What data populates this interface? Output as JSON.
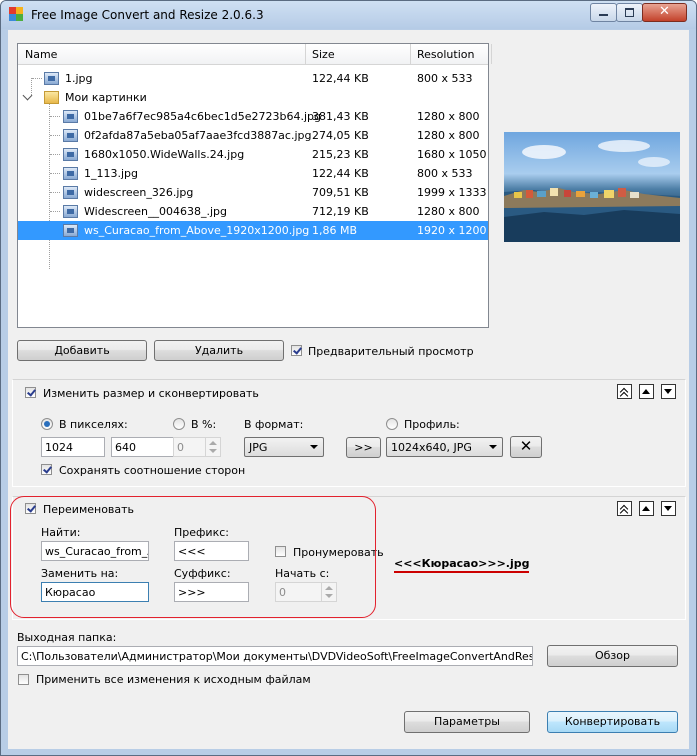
{
  "window": {
    "title": "Free Image Convert and Resize 2.0.6.3"
  },
  "filelist": {
    "columns": [
      "Name",
      "Size",
      "Resolution"
    ],
    "rows": [
      {
        "name": "1.jpg",
        "size": "122,44 KB",
        "res": "800 x 533"
      },
      {
        "name": "Мои картинки",
        "size": "",
        "res": ""
      },
      {
        "name": "01be7a6f7ec985a4c6bec1d5e2723b64.jpg",
        "size": "381,43 KB",
        "res": "1280 x 800"
      },
      {
        "name": "0f2afda87a5eba05af7aae3fcd3887ac.jpg",
        "size": "274,05 KB",
        "res": "1280 x 800"
      },
      {
        "name": "1680x1050.WideWalls.24.jpg",
        "size": "215,23 KB",
        "res": "1680 x 1050"
      },
      {
        "name": "1_113.jpg",
        "size": "122,44 KB",
        "res": "800 x 533"
      },
      {
        "name": "widescreen_326.jpg",
        "size": "709,51 KB",
        "res": "1999 x 1333"
      },
      {
        "name": "Widescreen__004638_.jpg",
        "size": "712,19 KB",
        "res": "1280 x 800"
      },
      {
        "name": "ws_Curacao_from_Above_1920x1200.jpg",
        "size": "1,86 MB",
        "res": "1920 x 1200"
      }
    ]
  },
  "buttons": {
    "add": "Добавить",
    "remove": "Удалить",
    "browse": "Обзор",
    "params": "Параметры",
    "convert": "Конвертировать",
    "arrow": ">>"
  },
  "preview_label": "Предварительный просмотр",
  "resize": {
    "header": "Изменить размер и сконвертировать",
    "pixels_label": "В пикселях:",
    "percent_label": "В %:",
    "format_label": "В формат:",
    "profile_label": "Профиль:",
    "width": "1024",
    "height": "640",
    "percent": "0",
    "format": "JPG",
    "profile": "1024x640, JPG",
    "keep_ratio": "Сохранять соотношение сторон"
  },
  "rename": {
    "header": "Переименовать",
    "find_label": "Найти:",
    "find_value": "ws_Curacao_from_Ab",
    "prefix_label": "Префикс:",
    "prefix_value": "<<<",
    "number_label": "Пронумеровать",
    "replace_label": "Заменить на:",
    "replace_value": "Кюрасао",
    "suffix_label": "Суффикс:",
    "suffix_value": ">>>",
    "start_label": "Начать с:",
    "start_value": "0",
    "result": "<<<Кюрасао>>>.jpg"
  },
  "output": {
    "label": "Выходная папка:",
    "path": "C:\\Пользователи\\Администратор\\Мои документы\\DVDVideoSoft\\FreeImageConvertAndResize\\",
    "apply_label": "Применить все изменения к исходным файлам"
  },
  "colors": {
    "selection": "#3399ff",
    "highlight": "#e2222e",
    "accent_result": "#cc0000"
  }
}
